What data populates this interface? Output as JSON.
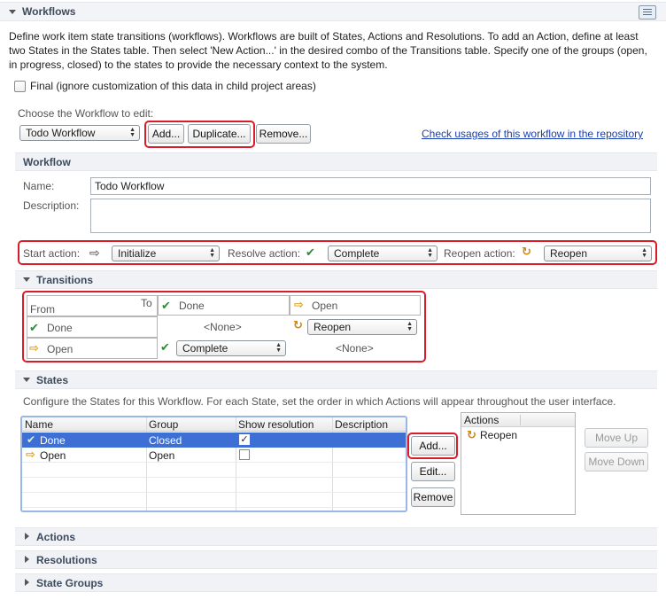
{
  "workflows": {
    "title": "Workflows",
    "description": "Define work item state transitions (workflows). Workflows are built of States, Actions and Resolutions. To add an Action, define at least two States in the States table. Then select 'New Action...' in the desired combo of the Transitions table. Specify one of the groups (open, in progress, closed) to the states to provide the necessary context to the system.",
    "final_checkbox_label": "Final (ignore customization of this data in child project areas)",
    "final_checked": false,
    "choose_label": "Choose the Workflow to edit:",
    "selected_workflow": "Todo Workflow",
    "add_label": "Add...",
    "duplicate_label": "Duplicate...",
    "remove_label": "Remove...",
    "usages_link": "Check usages of this workflow in the repository"
  },
  "workflow": {
    "title": "Workflow",
    "name_label": "Name:",
    "name_value": "Todo Workflow",
    "description_label": "Description:",
    "description_value": "",
    "start_action_label": "Start action:",
    "start_action_value": "Initialize",
    "resolve_action_label": "Resolve action:",
    "resolve_action_value": "Complete",
    "reopen_action_label": "Reopen action:",
    "reopen_action_value": "Reopen"
  },
  "transitions": {
    "title": "Transitions",
    "from_label": "From",
    "to_label": "To",
    "columns": [
      "Done",
      "Open"
    ],
    "rows": [
      {
        "from": "Done",
        "to_done": "<None>",
        "to_open": "Reopen"
      },
      {
        "from": "Open",
        "to_done": "Complete",
        "to_open": "<None>"
      }
    ]
  },
  "states": {
    "title": "States",
    "description": "Configure the States for this Workflow.  For each State, set the order in which Actions will appear throughout the user interface.",
    "headers": [
      "Name",
      "Group",
      "Show resolution",
      "Description"
    ],
    "rows": [
      {
        "name": "Done",
        "group": "Closed",
        "show_resolution": true,
        "description": "",
        "selected": true
      },
      {
        "name": "Open",
        "group": "Open",
        "show_resolution": false,
        "description": "",
        "selected": false
      }
    ],
    "add_label": "Add...",
    "edit_label": "Edit...",
    "remove_label": "Remove",
    "actions_header": "Actions",
    "actions": [
      "Reopen"
    ],
    "move_up_label": "Move Up",
    "move_down_label": "Move Down"
  },
  "collapsed_sections": {
    "actions": "Actions",
    "resolutions": "Resolutions",
    "state_groups": "State Groups"
  },
  "colors": {
    "highlight_red": "#d91c2a",
    "selection_blue": "#3d6fd4",
    "section_bar": "#f0f2f6",
    "link": "#1a3fb0"
  }
}
